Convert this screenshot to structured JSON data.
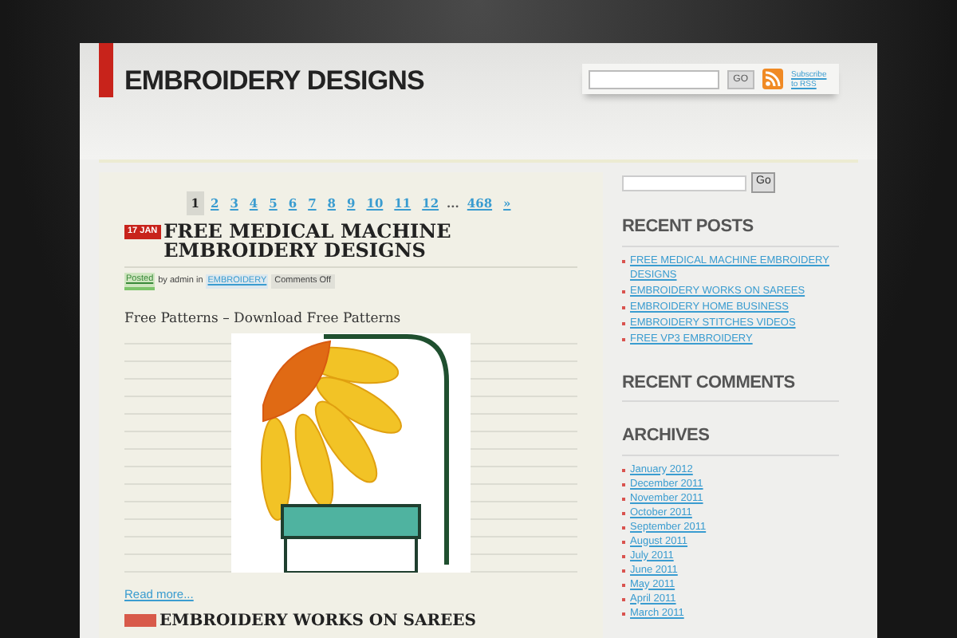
{
  "header": {
    "title": "EMBROIDERY DESIGNS",
    "search": {
      "button": "GO"
    },
    "subscribe": "Subscribe to RSS"
  },
  "pagination": [
    {
      "label": "1",
      "selected": true
    },
    {
      "label": "2",
      "selected": false
    },
    {
      "label": "3",
      "selected": false
    },
    {
      "label": "4",
      "selected": false
    },
    {
      "label": "5",
      "selected": false
    },
    {
      "label": "6",
      "selected": false
    },
    {
      "label": "7",
      "selected": false
    },
    {
      "label": "8",
      "selected": false
    },
    {
      "label": "9",
      "selected": false
    },
    {
      "label": "10",
      "selected": false
    },
    {
      "label": "11",
      "selected": false
    },
    {
      "label": "12",
      "selected": false
    },
    {
      "label": "...",
      "kind": "gap"
    },
    {
      "label": "468",
      "selected": false
    },
    {
      "label": "»",
      "selected": false
    }
  ],
  "posts": [
    {
      "date": "17 JAN",
      "title": "FREE MEDICAL MACHINE EMBROIDERY DESIGNS",
      "meta": {
        "posted": "Posted",
        "by": "by admin in",
        "category": "EMBROIDERY",
        "comments": "Comments Off"
      },
      "body": "Free Patterns – Download Free Patterns",
      "read_more": "Read more..."
    },
    {
      "title": "EMBROIDERY WORKS ON SAREES"
    }
  ],
  "sidebar": {
    "search": {
      "button": "Go"
    },
    "recent_posts": {
      "heading": "RECENT POSTS",
      "items": [
        "FREE MEDICAL MACHINE EMBROIDERY DESIGNS",
        "EMBROIDERY WORKS ON SAREES",
        "EMBROIDERY HOME BUSINESS",
        "EMBROIDERY STITCHES VIDEOS",
        "FREE VP3 EMBROIDERY"
      ]
    },
    "recent_comments": {
      "heading": "RECENT COMMENTS"
    },
    "archives": {
      "heading": "ARCHIVES",
      "items": [
        "January 2012",
        "December 2011",
        "November 2011",
        "October 2011",
        "September 2011",
        "August 2011",
        "July 2011",
        "June 2011",
        "May 2011",
        "April 2011",
        "March 2011"
      ]
    }
  }
}
